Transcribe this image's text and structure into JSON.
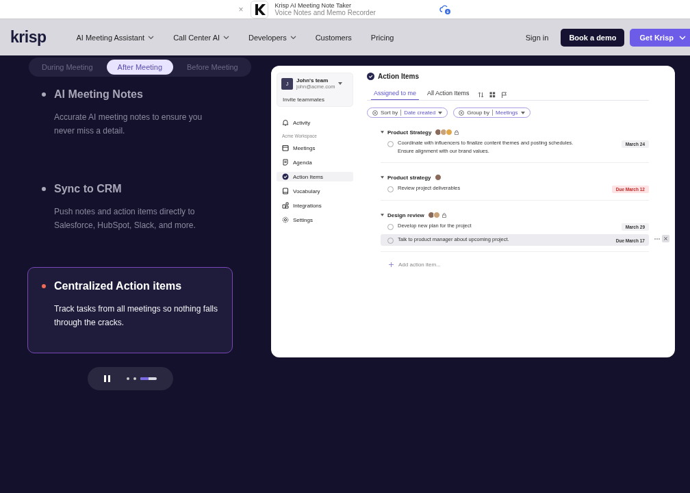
{
  "app_banner": {
    "close": "×",
    "title": "Krisp AI Meeting Note Taker",
    "subtitle": "Voice Notes and Memo Recorder"
  },
  "nav": {
    "logo": "krisp",
    "menu": [
      {
        "label": "AI Meeting Assistant",
        "dropdown": true
      },
      {
        "label": "Call Center AI",
        "dropdown": true
      },
      {
        "label": "Developers",
        "dropdown": true
      },
      {
        "label": "Customers",
        "dropdown": false
      },
      {
        "label": "Pricing",
        "dropdown": false
      }
    ],
    "sign_in": "Sign in",
    "book_demo": "Book a demo",
    "get_krisp": "Get Krisp"
  },
  "tabs": [
    {
      "label": "During Meeting",
      "selected": false
    },
    {
      "label": "After Meeting",
      "selected": true
    },
    {
      "label": "Before Meeting",
      "selected": false
    }
  ],
  "features": [
    {
      "title": "AI Meeting Notes",
      "text": "Accurate AI meeting notes to ensure you never miss a detail.",
      "selected": false
    },
    {
      "title": "Sync to CRM",
      "text": "Push notes and action items directly to Salesforce, HubSpot, Slack, and more.",
      "selected": false
    },
    {
      "title": "Centralized Action items",
      "text": "Track tasks from all meetings so nothing falls through the cracks.",
      "selected": true
    }
  ],
  "carousel": {
    "pages": [
      {
        "selected": false
      },
      {
        "selected": false
      },
      {
        "selected": true,
        "level": 0.5
      }
    ]
  },
  "app": {
    "team": {
      "initial": "J",
      "name": "John's team",
      "email": "john@acme.com",
      "invite": "Invite teammates"
    },
    "sidebar": [
      {
        "label": "Activity",
        "selected": false
      },
      {
        "kind": "heading",
        "label": "Acme Workspace"
      },
      {
        "label": "Meetings",
        "selected": false
      },
      {
        "label": "Agenda",
        "selected": false
      },
      {
        "label": "Action Items",
        "selected": true
      },
      {
        "label": "Vocabulary",
        "selected": false
      },
      {
        "label": "Integrations",
        "selected": false
      },
      {
        "label": "Settings",
        "selected": false
      }
    ],
    "title": "Action Items",
    "tabs": [
      {
        "label": "Assigned to me",
        "selected": true
      },
      {
        "label": "All Action Items",
        "selected": false
      }
    ],
    "filters": [
      {
        "label": "Sort by",
        "value": "Date created"
      },
      {
        "label": "Group by",
        "value": "Meetings"
      }
    ],
    "groups": [
      {
        "title": "Product Strategy",
        "locked": true,
        "items": [
          {
            "text": "Coordinate with influencers to finalize content themes and posting schedules. Ensure alignment with our brand values.",
            "date": "March 24",
            "overdue": false,
            "hovered": false
          }
        ]
      },
      {
        "title": "Product strategy",
        "locked": false,
        "items": [
          {
            "text": "Review project deliverables",
            "date": "Due March 12",
            "overdue": true,
            "hovered": false
          }
        ]
      },
      {
        "title": "Design review",
        "locked": true,
        "items": [
          {
            "text": "Develop new plan for the project",
            "date": "March 29",
            "overdue": false,
            "hovered": false
          },
          {
            "text": "Talk to product manager about upcoming project.",
            "date": "Due March 17",
            "overdue": false,
            "hovered": true
          }
        ]
      }
    ],
    "add": "Add action item..."
  }
}
